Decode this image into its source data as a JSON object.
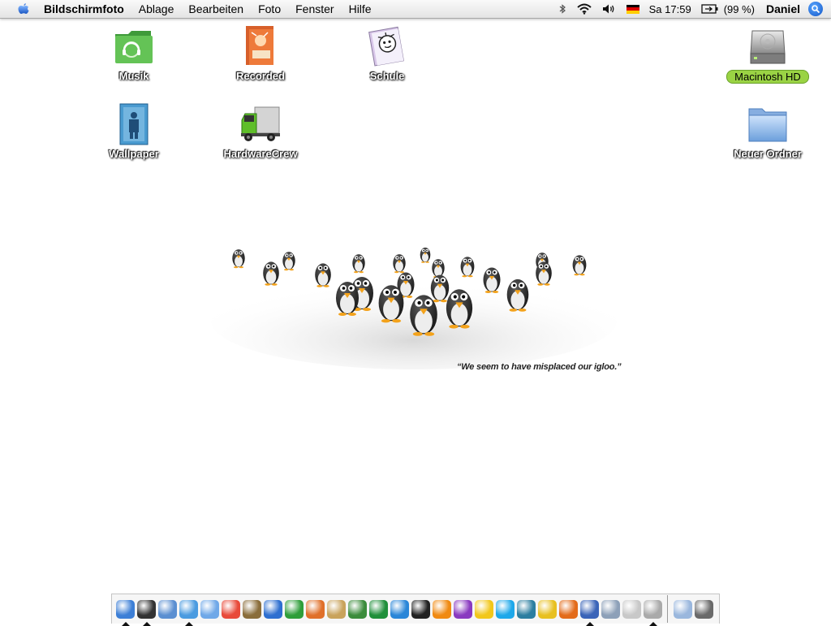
{
  "menubar": {
    "app_name": "Bildschirmfoto",
    "items": [
      "Ablage",
      "Bearbeiten",
      "Foto",
      "Fenster",
      "Hilfe"
    ],
    "status": {
      "clock": "Sa 17:59",
      "battery": "(99 %)",
      "user": "Daniel",
      "icons": [
        "bluetooth-icon",
        "wifi-icon",
        "volume-icon",
        "german-flag-icon",
        "battery-icon",
        "spotlight-icon"
      ]
    }
  },
  "desktop": {
    "icons": [
      {
        "label": "Musik",
        "icon": "music-folder-icon"
      },
      {
        "label": "Recorded",
        "icon": "recorded-document-icon"
      },
      {
        "label": "Schule",
        "icon": "schule-document-icon"
      },
      {
        "label": "Macintosh HD",
        "icon": "hard-drive-icon",
        "selected": true
      },
      {
        "label": "Wallpaper",
        "icon": "wallpaper-document-icon"
      },
      {
        "label": "HardwareCrew",
        "icon": "truck-icon"
      },
      {
        "label": "Neuer Ordner",
        "icon": "folder-icon"
      }
    ]
  },
  "wallpaper": {
    "quote": "“We seem to have misplaced our igloo.”"
  },
  "dock": {
    "apps": [
      {
        "icon": "finder-icon",
        "color": "#3d7fd6",
        "running": true
      },
      {
        "icon": "dashboard-icon",
        "color": "#333333",
        "running": true
      },
      {
        "icon": "preview-icon",
        "color": "#5b8fd1",
        "running": false
      },
      {
        "icon": "safari-icon",
        "color": "#4a9be0",
        "running": true
      },
      {
        "icon": "itunes-icon",
        "color": "#6fa8e8",
        "running": false
      },
      {
        "icon": "ical-icon",
        "color": "#e84a3a",
        "running": false
      },
      {
        "icon": "iphoto-icon",
        "color": "#8a6d3b",
        "running": false
      },
      {
        "icon": "word-icon",
        "color": "#2e6fd0",
        "running": false
      },
      {
        "icon": "excel-icon",
        "color": "#2f9e3a",
        "running": false
      },
      {
        "icon": "powerpoint-icon",
        "color": "#e0702a",
        "running": false
      },
      {
        "icon": "address-book-icon",
        "color": "#c9a35c",
        "running": false
      },
      {
        "icon": "mail-icon",
        "color": "#3c8c3c",
        "running": false
      },
      {
        "icon": "skype-s-icon",
        "color": "#1f8f3a",
        "running": false
      },
      {
        "icon": "camino-icon",
        "color": "#2a86d8",
        "running": false
      },
      {
        "icon": "terminal-icon",
        "color": "#222222",
        "running": false
      },
      {
        "icon": "vlc-icon",
        "color": "#f08a12",
        "running": false
      },
      {
        "icon": "adium-icon",
        "color": "#8a3ac0",
        "running": false
      },
      {
        "icon": "yahoo-messenger-icon",
        "color": "#f2c71b",
        "running": false
      },
      {
        "icon": "skype-icon",
        "color": "#1ea8ea",
        "running": false
      },
      {
        "icon": "chess-icon",
        "color": "#2c7ea0",
        "running": false
      },
      {
        "icon": "banana-icon",
        "color": "#e8c020",
        "running": false
      },
      {
        "icon": "firefox-icon",
        "color": "#e36b1a",
        "running": false
      },
      {
        "icon": "screen-sharing-icon",
        "color": "#3a64b8",
        "running": true
      },
      {
        "icon": "phone-icon",
        "color": "#8da0b8",
        "running": false
      },
      {
        "icon": "iweb-icon",
        "color": "#c8c8c8",
        "running": false
      },
      {
        "icon": "grab-icon",
        "color": "#aaaaaa",
        "running": true
      }
    ],
    "docs": [
      {
        "icon": "stack-icon",
        "color": "#9ab7dd"
      },
      {
        "icon": "trash-icon",
        "color": "#6a6a6a"
      }
    ]
  }
}
